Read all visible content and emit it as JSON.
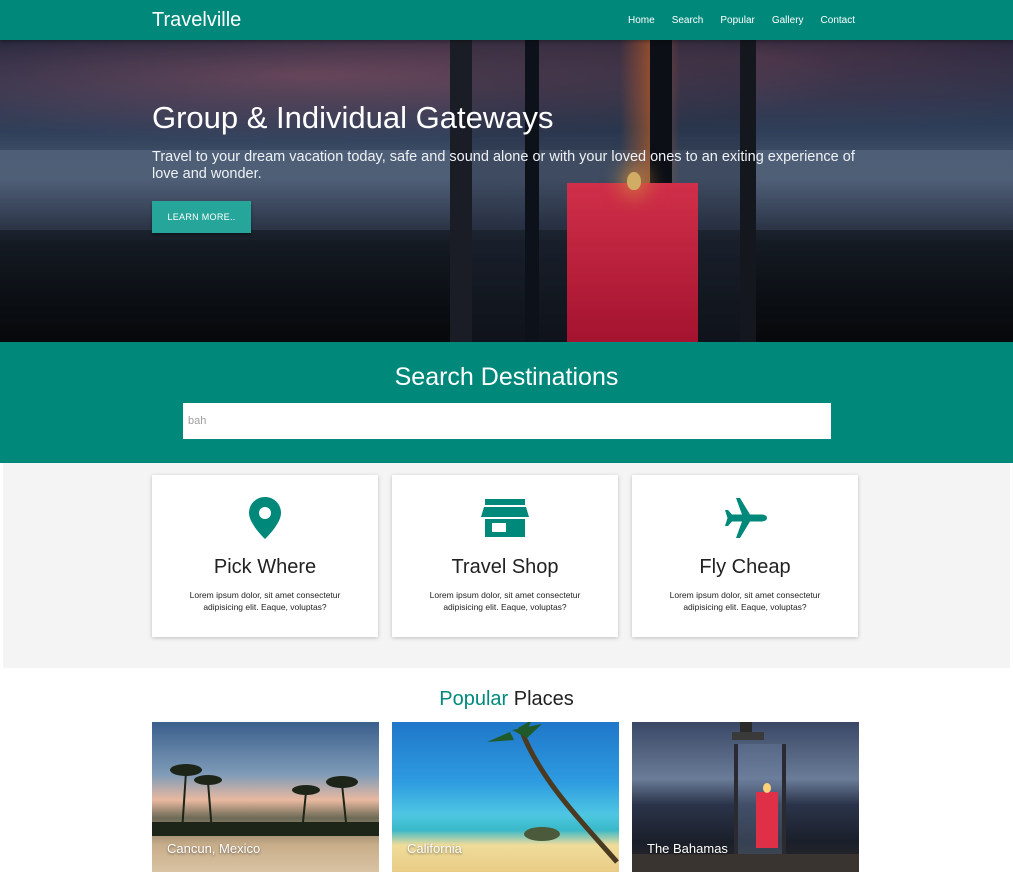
{
  "nav": {
    "brand": "Travelville",
    "links": [
      "Home",
      "Search",
      "Popular",
      "Gallery",
      "Contact"
    ]
  },
  "hero": {
    "title": "Group & Individual Gateways",
    "text": "Travel to your dream vacation today, safe and sound alone or with your loved ones to an exiting experience of love and wonder.",
    "button": "LEARN MORE.."
  },
  "search": {
    "title": "Search Destinations",
    "value": "bah"
  },
  "features": [
    {
      "icon": "map-pin-icon",
      "title": "Pick Where",
      "text": "Lorem ipsum dolor, sit amet consectetur adipisicing elit. Eaque, voluptas?"
    },
    {
      "icon": "store-icon",
      "title": "Travel Shop",
      "text": "Lorem ipsum dolor, sit amet consectetur adipisicing elit. Eaque, voluptas?"
    },
    {
      "icon": "airplane-icon",
      "title": "Fly Cheap",
      "text": "Lorem ipsum dolor, sit amet consectetur adipisicing elit. Eaque, voluptas?"
    }
  ],
  "popular": {
    "title_accent": "Popular",
    "title_rest": "Places",
    "places": [
      "Cancun, Mexico",
      "California",
      "The Bahamas"
    ]
  },
  "colors": {
    "primary": "#00897b",
    "button": "#26a69a",
    "section_bg": "#f4f4f4"
  }
}
